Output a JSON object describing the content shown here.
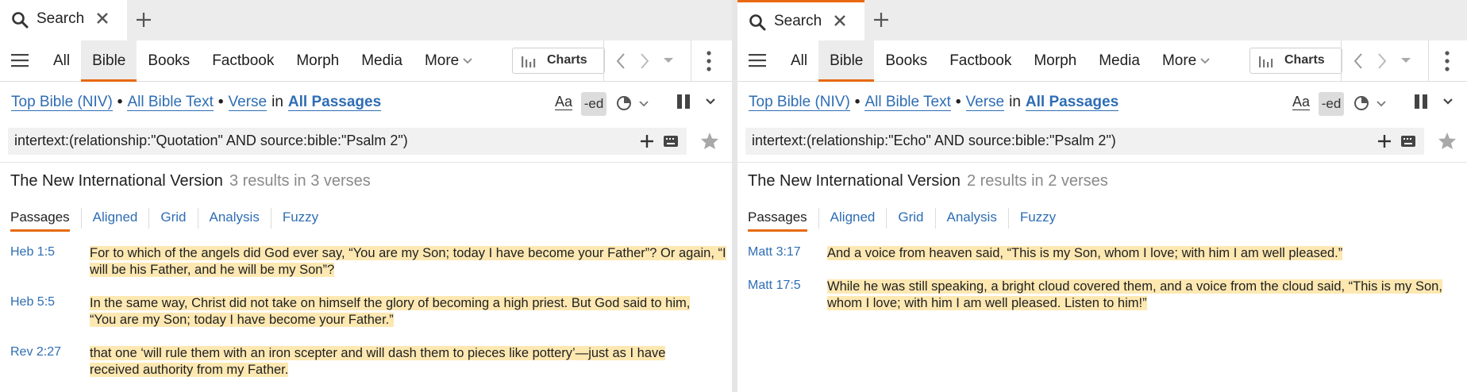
{
  "panes": [
    {
      "tab_title": "Search",
      "nav": {
        "items": [
          "All",
          "Bible",
          "Books",
          "Factbook",
          "Morph",
          "Media",
          "More"
        ],
        "active": "Bible",
        "charts_label": "Charts"
      },
      "scope": {
        "bible": "Top Bible (NIV)",
        "range": "All Bible Text",
        "unit": "Verse",
        "in_word": "in",
        "passages": "All Passages"
      },
      "tools": {
        "font_label": "Aa",
        "ed_label": "-ed"
      },
      "query": "intertext:(relationship:\"Quotation\" AND source:bible:\"Psalm 2\")",
      "results_header": {
        "version": "The New International Version",
        "count": "3 results in 3 verses"
      },
      "subtabs": [
        "Passages",
        "Aligned",
        "Grid",
        "Analysis",
        "Fuzzy"
      ],
      "results": [
        {
          "ref": "Heb 1:5",
          "lines": [
            "For to which of the angels did God ever say, “You are my Son; today I have become your Father”? Or again, “I",
            "will be his Father, and he will be my Son”?"
          ]
        },
        {
          "ref": "Heb 5:5",
          "lines": [
            "In the same way, Christ did not take on himself the glory of becoming a high priest. But God said to him,",
            "“You are my Son; today I have become your Father.”"
          ]
        },
        {
          "ref": "Rev 2:27",
          "lines": [
            "that one ‘will rule them with an iron scepter and will dash them to pieces like pottery’—just as I have",
            "received authority from my Father."
          ]
        }
      ]
    },
    {
      "tab_title": "Search",
      "nav": {
        "items": [
          "All",
          "Bible",
          "Books",
          "Factbook",
          "Morph",
          "Media",
          "More"
        ],
        "active": "Bible",
        "charts_label": "Charts"
      },
      "scope": {
        "bible": "Top Bible (NIV)",
        "range": "All Bible Text",
        "unit": "Verse",
        "in_word": "in",
        "passages": "All Passages"
      },
      "tools": {
        "font_label": "Aa",
        "ed_label": "-ed"
      },
      "query": "intertext:(relationship:\"Echo\" AND source:bible:\"Psalm 2\")",
      "results_header": {
        "version": "The New International Version",
        "count": "2 results in 2 verses"
      },
      "subtabs": [
        "Passages",
        "Aligned",
        "Grid",
        "Analysis",
        "Fuzzy"
      ],
      "results": [
        {
          "ref": "Matt 3:17",
          "lines": [
            "And a voice from heaven said, “This is my Son, whom I love; with him I am well pleased.”"
          ]
        },
        {
          "ref": "Matt 17:5",
          "lines": [
            "While he was still speaking, a bright cloud covered them, and a voice from the cloud said, “This is my Son,",
            "whom I love; with him I am well pleased. Listen to him!”"
          ]
        }
      ]
    }
  ],
  "colors": {
    "accent": "#e8690f",
    "link": "#2e6db4",
    "highlight": "#fde8b2"
  }
}
